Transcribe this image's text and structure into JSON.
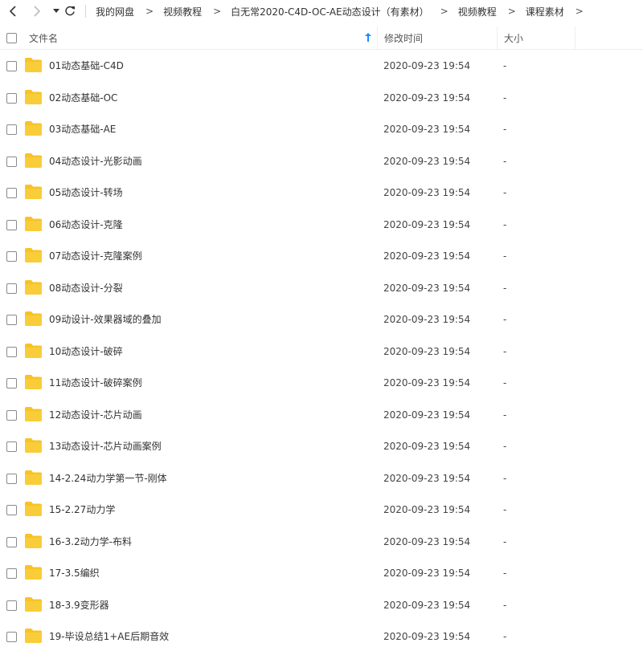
{
  "toolbar": {
    "breadcrumbs": [
      "我的网盘",
      "视频教程",
      "白无常2020-C4D-OC-AE动态设计（有素材）",
      "视频教程",
      "课程素材"
    ],
    "separator": ">"
  },
  "columns": {
    "name": "文件名",
    "time": "修改时间",
    "size": "大小"
  },
  "accent_color": "#1a8cff",
  "folder_color": "#f7c325",
  "files": [
    {
      "name": "01动态基础-C4D",
      "time": "2020-09-23 19:54",
      "size": "-"
    },
    {
      "name": "02动态基础-OC",
      "time": "2020-09-23 19:54",
      "size": "-"
    },
    {
      "name": "03动态基础-AE",
      "time": "2020-09-23 19:54",
      "size": "-"
    },
    {
      "name": "04动态设计-光影动画",
      "time": "2020-09-23 19:54",
      "size": "-"
    },
    {
      "name": "05动态设计-转场",
      "time": "2020-09-23 19:54",
      "size": "-"
    },
    {
      "name": "06动态设计-克隆",
      "time": "2020-09-23 19:54",
      "size": "-"
    },
    {
      "name": "07动态设计-克隆案例",
      "time": "2020-09-23 19:54",
      "size": "-"
    },
    {
      "name": "08动态设计-分裂",
      "time": "2020-09-23 19:54",
      "size": "-"
    },
    {
      "name": "09动设计-效果器域的叠加",
      "time": "2020-09-23 19:54",
      "size": "-"
    },
    {
      "name": "10动态设计-破碎",
      "time": "2020-09-23 19:54",
      "size": "-"
    },
    {
      "name": "11动态设计-破碎案例",
      "time": "2020-09-23 19:54",
      "size": "-"
    },
    {
      "name": "12动态设计-芯片动画",
      "time": "2020-09-23 19:54",
      "size": "-"
    },
    {
      "name": "13动态设计-芯片动画案例",
      "time": "2020-09-23 19:54",
      "size": "-"
    },
    {
      "name": "14-2.24动力学第一节-刚体",
      "time": "2020-09-23 19:54",
      "size": "-"
    },
    {
      "name": "15-2.27动力学",
      "time": "2020-09-23 19:54",
      "size": "-"
    },
    {
      "name": "16-3.2动力学-布料",
      "time": "2020-09-23 19:54",
      "size": "-"
    },
    {
      "name": "17-3.5编织",
      "time": "2020-09-23 19:54",
      "size": "-"
    },
    {
      "name": "18-3.9变形器",
      "time": "2020-09-23 19:54",
      "size": "-"
    },
    {
      "name": "19-毕设总结1+AE后期音效",
      "time": "2020-09-23 19:54",
      "size": "-"
    }
  ]
}
